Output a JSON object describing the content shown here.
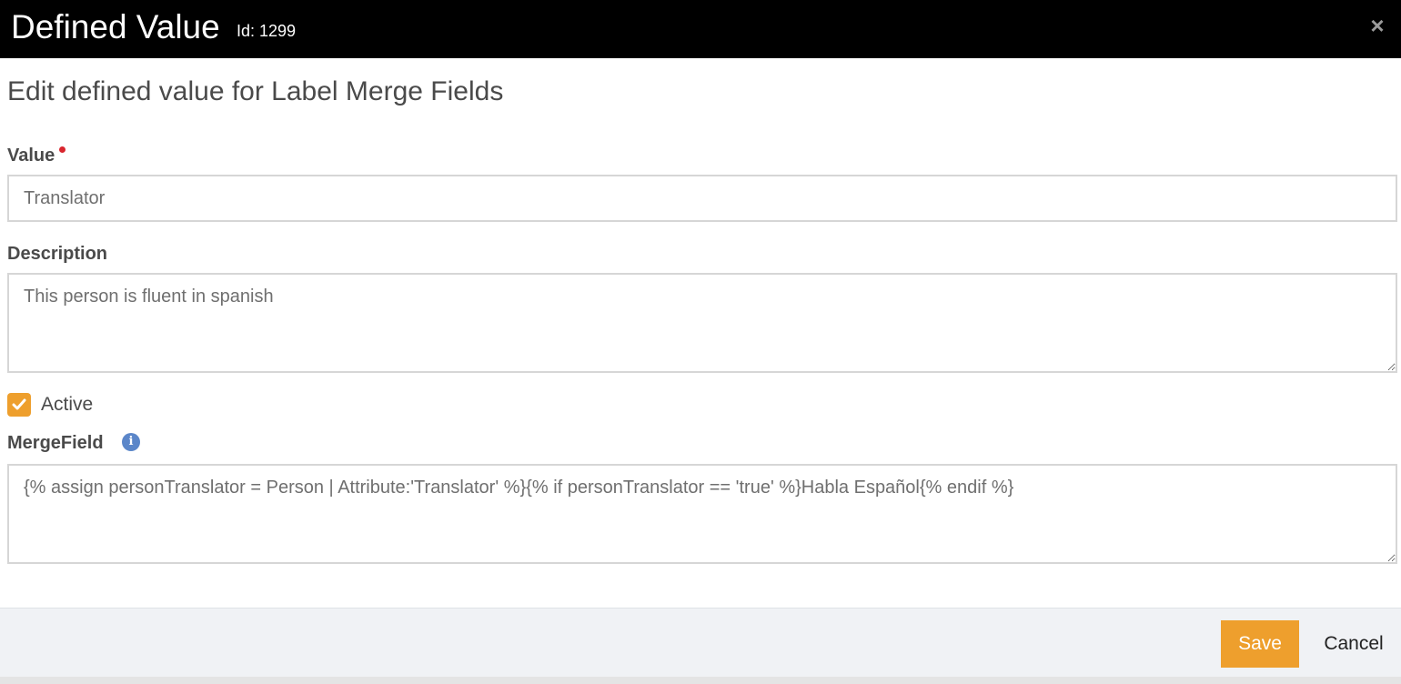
{
  "header": {
    "title": "Defined Value",
    "id_label": "Id: 1299",
    "close_glyph": "×"
  },
  "subtitle": "Edit defined value for Label Merge Fields",
  "form": {
    "value_label": "Value",
    "value_text": "Translator",
    "description_label": "Description",
    "description_text": "This person is fluent in spanish",
    "active_label": "Active",
    "active_checked": true,
    "mergefield_label": "MergeField",
    "mergefield_text": "{% assign personTranslator = Person | Attribute:'Translator' %}{% if personTranslator == 'true' %}Habla Español{% endif %}",
    "info_glyph": "i"
  },
  "footer": {
    "save_label": "Save",
    "cancel_label": "Cancel"
  },
  "colors": {
    "accent": "#ee9f2d",
    "required": "#d9262e",
    "info": "#5b86c9",
    "header_bg": "#000000"
  }
}
